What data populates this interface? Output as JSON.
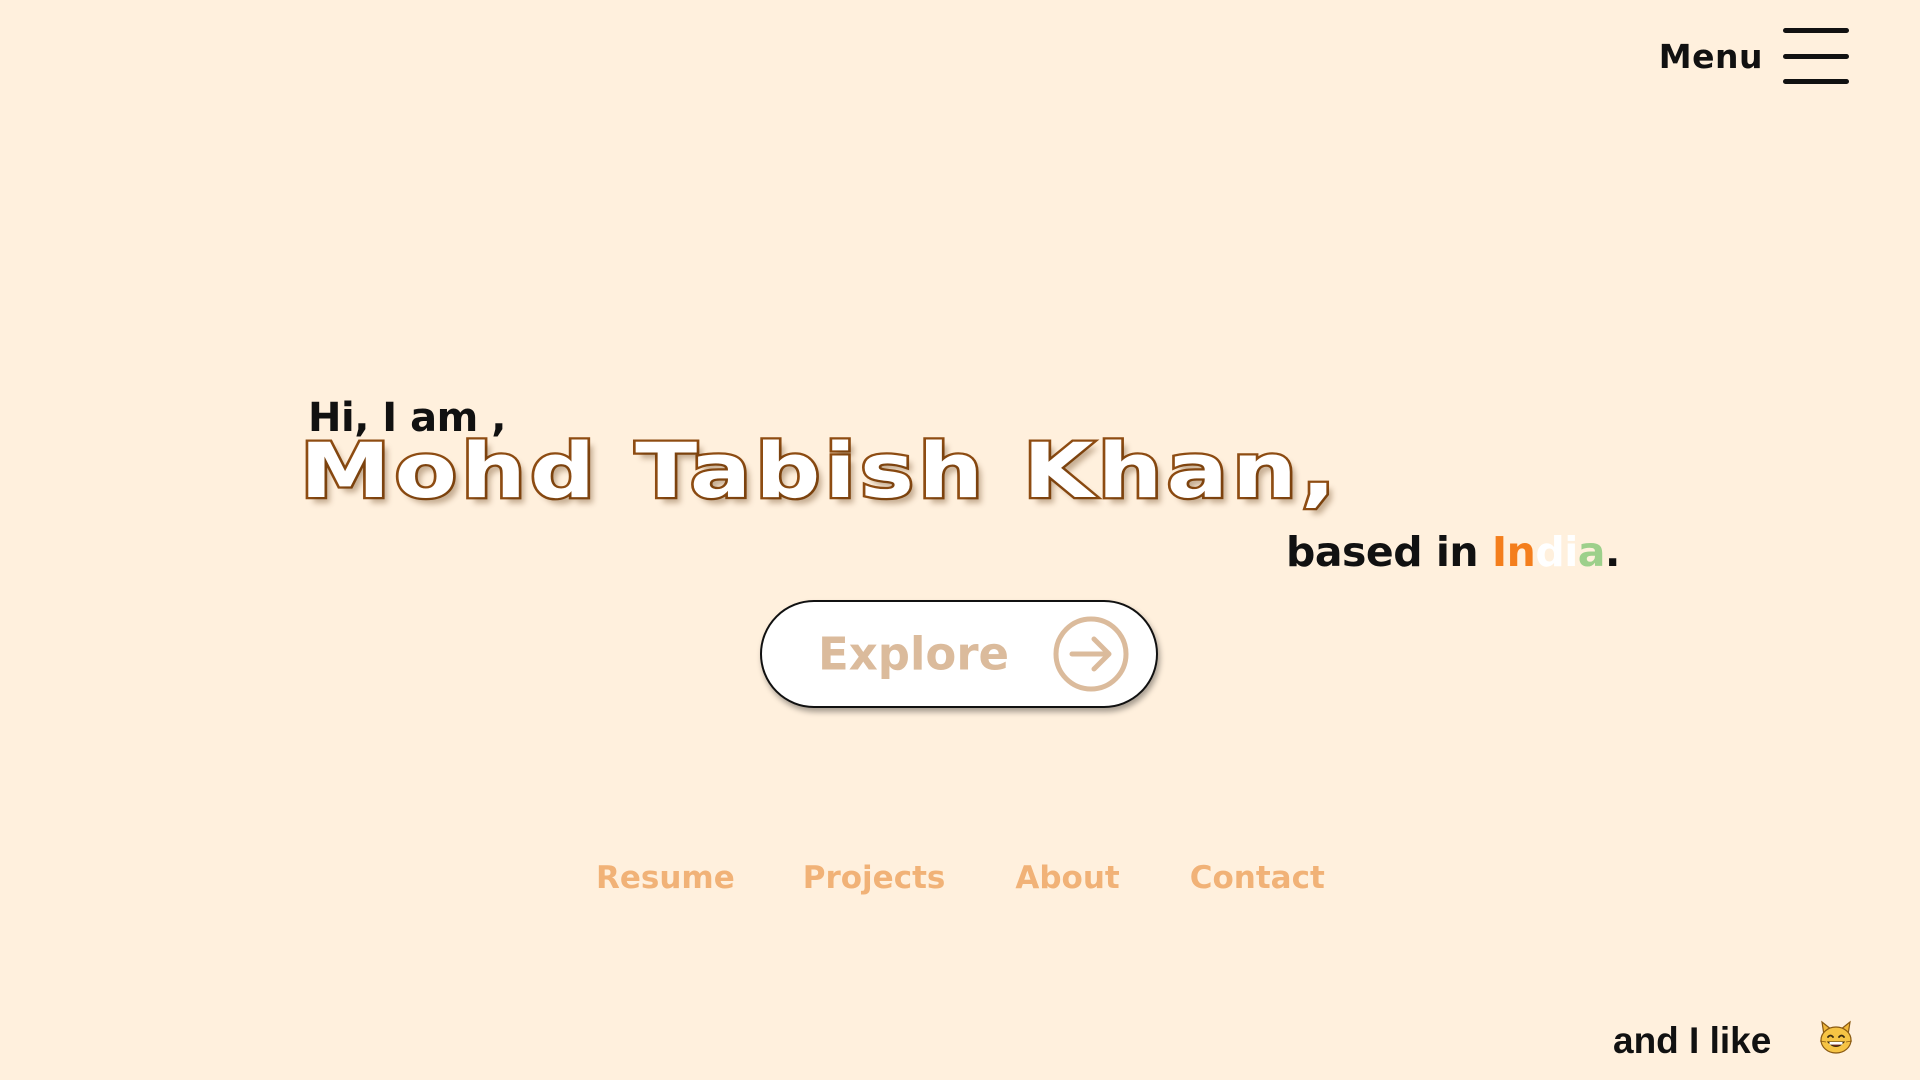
{
  "menu": {
    "label": "Menu",
    "icon": "hamburger-icon"
  },
  "hero": {
    "greeting": "Hi, I am ,",
    "name": "Mohd Tabish Khan,",
    "location_prefix": "based in ",
    "country_letters": [
      "In",
      "d",
      "i",
      "a"
    ],
    "location_suffix": ".",
    "colors": {
      "name_outline": "#8e4c12",
      "saffron": "#f47e1c",
      "white": "#ffffff",
      "green": "#9dd08b"
    }
  },
  "explore_button": {
    "label": "Explore",
    "icon": "arrow-right-circle-icon",
    "color": "#dbbb9c"
  },
  "bottom_nav": {
    "items": [
      {
        "label": "Resume"
      },
      {
        "label": "Projects"
      },
      {
        "label": "About"
      },
      {
        "label": "Contact"
      }
    ],
    "color": "#f1b277"
  },
  "likes": {
    "text": "and I like",
    "icon": "grinning-cat-emoji-icon"
  },
  "background_color": "#fff0dd"
}
